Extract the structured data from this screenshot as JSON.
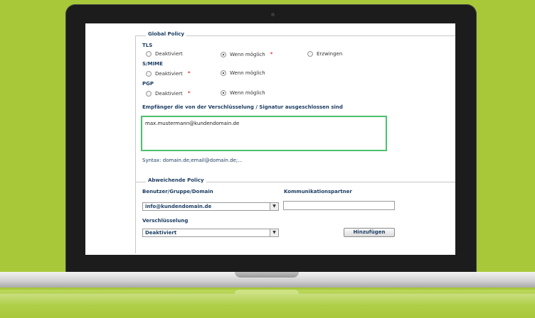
{
  "global_policy": {
    "legend": "Global Policy",
    "tls": {
      "label": "TLS",
      "options": [
        {
          "label": "Deaktiviert",
          "selected": false,
          "required": false
        },
        {
          "label": "Wenn möglich",
          "selected": true,
          "required": true
        },
        {
          "label": "Erzwingen",
          "selected": false,
          "required": false
        }
      ]
    },
    "smime": {
      "label": "S/MIME",
      "options": [
        {
          "label": "Deaktiviert",
          "selected": false,
          "required": true
        },
        {
          "label": "Wenn möglich",
          "selected": true,
          "required": false
        }
      ]
    },
    "pgp": {
      "label": "PGP",
      "options": [
        {
          "label": "Deaktiviert",
          "selected": false,
          "required": true
        },
        {
          "label": "Wenn möglich",
          "selected": true,
          "required": false
        }
      ]
    },
    "excluded_label": "Empfänger die von der Verschlüsselung / Signatur ausgeschlossen sind",
    "excluded_value": "max.mustermann@kundendomain.de",
    "syntax_hint": "Syntax: domain.de;email@domain.de;..."
  },
  "deviating_policy": {
    "legend": "Abweichende Policy",
    "user_label": "Benutzer/Gruppe/Domain",
    "user_value": "info@kundendomain.de",
    "partner_label": "Kommunikationspartner",
    "partner_value": "",
    "encryption_label": "Verschlüsselung",
    "encryption_value": "Deaktiviert",
    "add_button": "Hinzufügen"
  },
  "required_marker": "*",
  "colors": {
    "background": "#a8c83a",
    "label": "#1d3e63",
    "focus": "#4cc06e",
    "required": "#e02020"
  }
}
